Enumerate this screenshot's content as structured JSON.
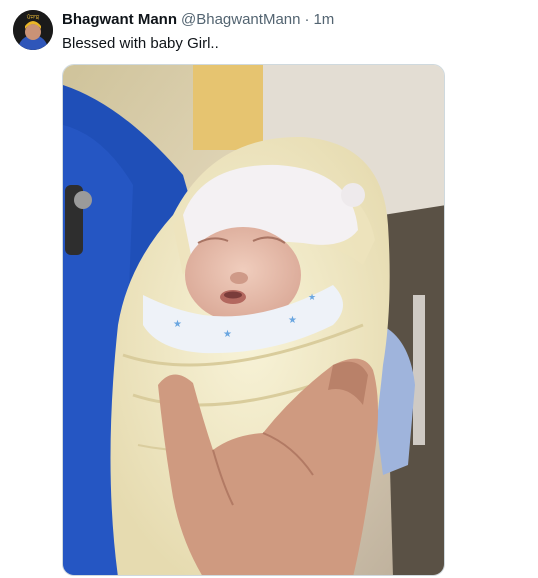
{
  "tweet": {
    "author": {
      "display_name": "Bhagwant Mann",
      "handle": "@BhagwantMann",
      "avatar_icon": "profile-photo",
      "avatar_badge_text": "ਪੰਜਾਬ"
    },
    "separator": "·",
    "timestamp": "1m",
    "text": "Blessed with baby Girl..",
    "media": {
      "type": "photo",
      "accent_colors": {
        "scrubs": "#1f4fb8",
        "blanket": "#f2eac6",
        "hat": "#f4f1f3",
        "skin": "#e8bfae"
      }
    }
  }
}
